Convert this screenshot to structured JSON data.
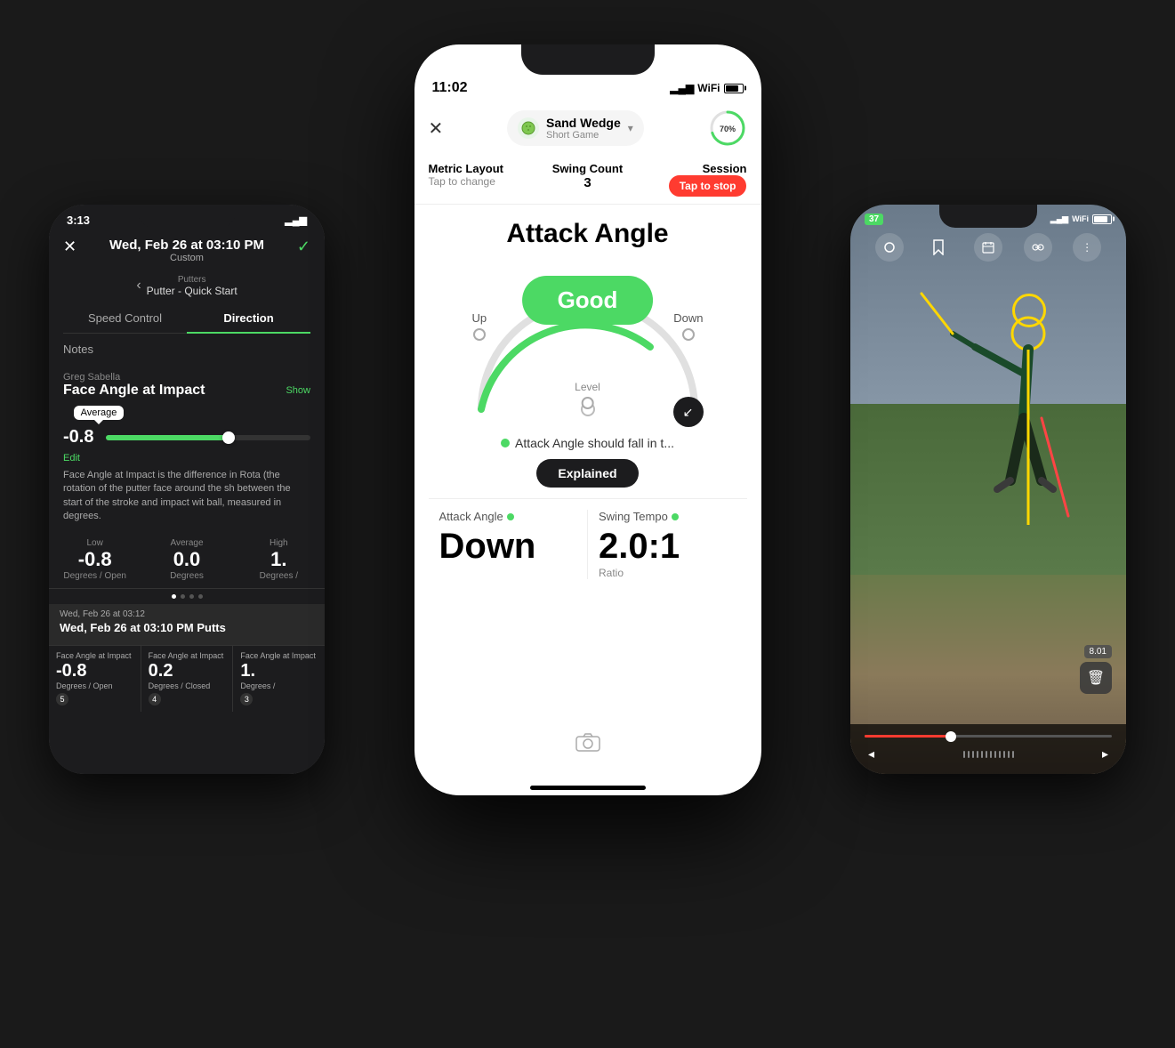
{
  "left_phone": {
    "status_bar": {
      "time": "3:13",
      "location_icon": "◂",
      "signal": "▂▄▆"
    },
    "header": {
      "close_btn": "✕",
      "title": "Wed, Feb 26 at 03:10 PM",
      "subtitle": "Custom",
      "check_btn": "✓"
    },
    "club_nav": {
      "back_arrow": "‹",
      "club_category": "Putters",
      "club_name": "Putter - Quick Start"
    },
    "tabs": [
      {
        "label": "Speed Control",
        "active": false
      },
      {
        "label": "Direction",
        "active": true
      }
    ],
    "notes_label": "Notes",
    "metric_section": {
      "author": "Greg Sabella",
      "metric_name": "Face Angle at Impact",
      "show_btn": "Show",
      "avg_tooltip": "Average",
      "slider_value": "-0.8",
      "edit_label": "Edit",
      "description": "Face Angle at Impact is the difference in Rota (the rotation of the putter face around the sh between the start of the stroke and impact wit ball, measured in degrees."
    },
    "stats": {
      "low_label": "Low",
      "avg_label": "Average",
      "high_label": "High",
      "low_val": "-0.8",
      "avg_val": "0.0",
      "high_val": "1.",
      "low_unit": "Degrees / Open",
      "avg_unit": "Degrees",
      "high_unit": "Degrees /"
    },
    "session_date": "Wed, Feb 26 at 03:12",
    "session_title": "Wed, Feb 26 at 03:10 PM Putts",
    "cards": [
      {
        "label": "Face Angle at Impact",
        "val": "-0.8",
        "unit": "Degrees / Open",
        "badge": "5"
      },
      {
        "label": "Face Angle at Impact",
        "val": "0.2",
        "unit": "Degrees / Closed",
        "badge": "4"
      },
      {
        "label": "Face Angle at Impact",
        "val": "1.",
        "unit": "Degrees /",
        "badge": "3"
      }
    ]
  },
  "center_phone": {
    "status_bar": {
      "time": "11:02",
      "location_icon": "◂"
    },
    "nav": {
      "close_btn": "✕",
      "club_icon": "🏌",
      "club_name": "Sand Wedge",
      "club_sub": "Short Game",
      "chevron": "▾",
      "ring_percent": "70%"
    },
    "metrics_bar": {
      "layout_label": "Metric Layout",
      "layout_sub": "Tap to change",
      "count_label": "Swing Count",
      "count_val": "3",
      "session_label": "Session",
      "session_btn": "Tap to stop"
    },
    "main": {
      "title": "Attack Angle",
      "good_label": "Good",
      "gauge_up": "Up",
      "gauge_down": "Down",
      "gauge_level": "Level",
      "info_text": "Attack Angle should fall in t...",
      "explained_btn": "Explained"
    },
    "bottom": {
      "attack_label": "Attack Angle",
      "attack_val": "Down",
      "tempo_label": "Swing Tempo",
      "tempo_val": "2.0:1",
      "tempo_unit": "Ratio"
    },
    "camera_btn": "📷",
    "home_indicator": true
  },
  "right_phone": {
    "status_bar": {
      "time": "37",
      "wifi": "wifi",
      "battery": "battery"
    },
    "toolbar_btns": [
      "circle",
      "bookmark",
      "calendar",
      "link",
      "more"
    ],
    "timestamp": "8.01",
    "trash_btn": "🗑"
  },
  "colors": {
    "green": "#4cd964",
    "red": "#ff3b30",
    "dark": "#1c1c1e",
    "yellow": "#ffd700"
  }
}
